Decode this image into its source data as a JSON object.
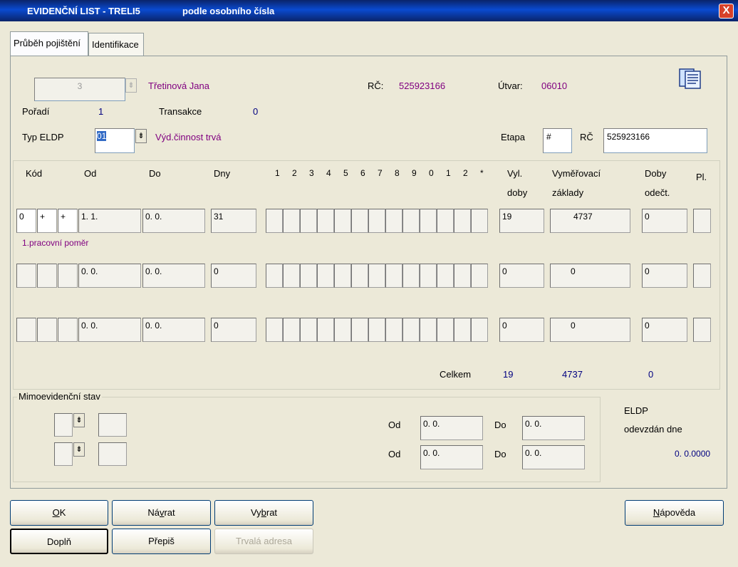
{
  "window": {
    "title_left": "EVIDENČNÍ LIST - TRELI5",
    "title_right": "podle osobního čísla",
    "close_label": "X"
  },
  "tabs": [
    {
      "label": "Průběh pojištění",
      "active": true
    },
    {
      "label": "Identifikace",
      "active": false
    }
  ],
  "header": {
    "person_number": "3",
    "person_name": "Třetinová Jana",
    "rc_label": "RČ:",
    "rc_value": "525923166",
    "utvar_label": "Útvar:",
    "utvar_value": "06010",
    "poradi_label": "Pořadí",
    "poradi_value": "1",
    "transakce_label": "Transakce",
    "transakce_value": "0",
    "typ_label": "Typ ELDP",
    "typ_value": "01",
    "typ_desc": "Výd.činnost trvá",
    "etapa_label": "Etapa",
    "etapa_value": "#",
    "rc2_label": "RČ",
    "rc2_value": "525923166"
  },
  "table": {
    "headers": {
      "kod": "Kód",
      "od": "Od",
      "do": "Do",
      "dny": "Dny",
      "months": [
        "1",
        "2",
        "3",
        "4",
        "5",
        "6",
        "7",
        "8",
        "9",
        "0",
        "1",
        "2",
        "*"
      ],
      "vyl1": "Vyl.",
      "vyl2": "doby",
      "vym1": "Vyměřovací",
      "vym2": "základy",
      "dob1": "Doby",
      "dob2": "odečt.",
      "pl": "Pl."
    },
    "rows": [
      {
        "k1": "0",
        "k2": "+",
        "k3": "+",
        "od": "1. 1.",
        "do": "0. 0.",
        "dny": "31",
        "vyl": "19",
        "vym": "4737",
        "dob": "0",
        "pl": "",
        "note": "1.pracovní poměr"
      },
      {
        "k1": "",
        "k2": "",
        "k3": "",
        "od": "0. 0.",
        "do": "0. 0.",
        "dny": "0",
        "vyl": "0",
        "vym": "0",
        "dob": "0",
        "pl": "",
        "note": ""
      },
      {
        "k1": "",
        "k2": "",
        "k3": "",
        "od": "0. 0.",
        "do": "0. 0.",
        "dny": "0",
        "vyl": "0",
        "vym": "0",
        "dob": "0",
        "pl": "",
        "note": ""
      }
    ],
    "totals": {
      "label": "Celkem",
      "vyl": "19",
      "vym": "4737",
      "dob": "0"
    }
  },
  "mimo": {
    "label": "Mimoevidenční stav",
    "od_label": "Od",
    "do_label": "Do",
    "rows": [
      {
        "od": "0. 0.",
        "do": "0. 0."
      },
      {
        "od": "0. 0.",
        "do": "0. 0."
      }
    ]
  },
  "eldp": {
    "line1": "ELDP",
    "line2": "odevzdán dne",
    "date": "0. 0.0000"
  },
  "buttons": {
    "ok_pre": "",
    "ok_u": "O",
    "ok_post": "K",
    "navrat_pre": "Ná",
    "navrat_u": "v",
    "navrat_post": "rat",
    "vybrat_pre": "Vy",
    "vybrat_u": "b",
    "vybrat_post": "rat",
    "napoveda_pre": "",
    "napoveda_u": "N",
    "napoveda_post": "ápověda",
    "dopln": "Doplň",
    "prepis": "Přepiš",
    "trvala": "Trvalá adresa"
  },
  "colors": {
    "purple": "#800080",
    "navy": "#000080",
    "titlebar": "#0a246a"
  }
}
